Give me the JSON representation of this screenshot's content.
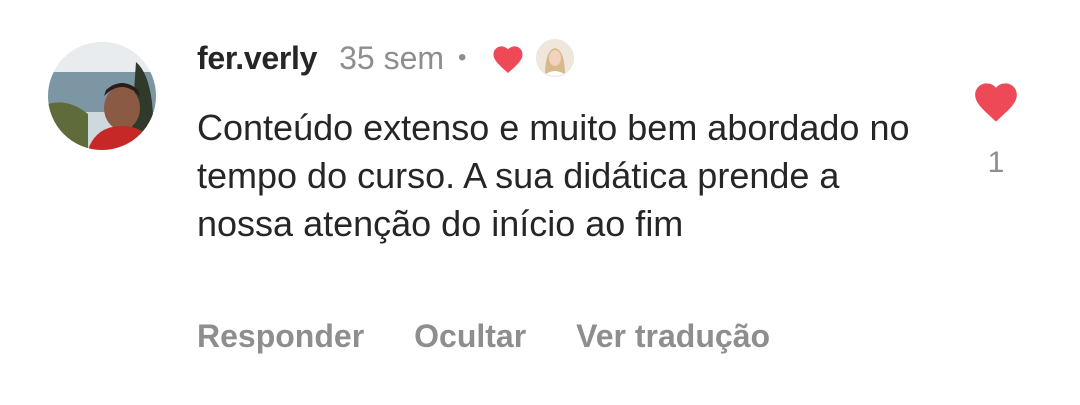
{
  "comment": {
    "username": "fer.verly",
    "time": "35 sem",
    "separator": "•",
    "text": "Conteúdo extenso e muito bem abordado no tempo do curso. A sua didática prende a nossa atenção do início ao fim",
    "like_count": "1",
    "liked_by_creator": true
  },
  "actions": {
    "reply_label": "Responder",
    "hide_label": "Ocultar",
    "translate_label": "Ver tradução"
  },
  "icons": {
    "avatar": "user-avatar",
    "creator_heart": "heart-icon",
    "creator_avatar": "creator-avatar",
    "like": "heart-icon"
  },
  "colors": {
    "heart": "#ed4956",
    "text": "#262626",
    "secondary": "#8e8e8e",
    "background": "#ffffff"
  }
}
